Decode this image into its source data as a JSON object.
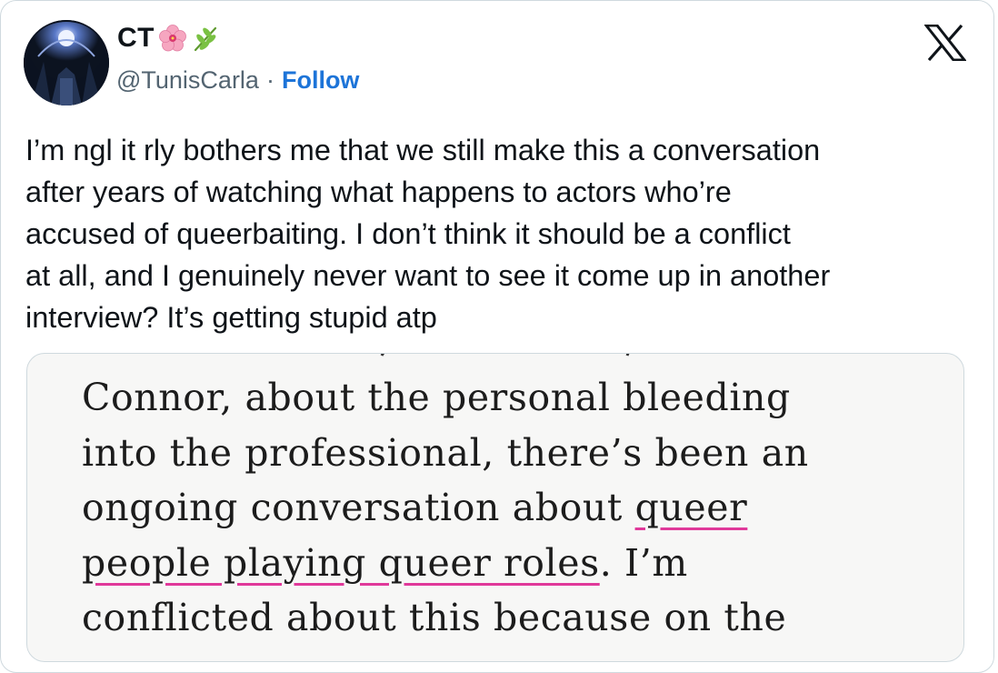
{
  "author": {
    "display_name": "CT",
    "handle": "@TunisCarla",
    "separator": "·",
    "follow_label": "Follow",
    "emoji_names": [
      "hibiscus-icon",
      "herb-icon"
    ]
  },
  "tweet": {
    "lines": [
      "I’m ngl it rly bothers me that we still make this a conversation",
      "after years of watching what happens to actors who’re",
      "accused of queerbaiting. I don’t think it should be a conflict",
      "at all, and I genuinely never want to see it come up in another",
      "interview? It’s getting stupid atp"
    ]
  },
  "media": {
    "line1": "Connor, about the personal bleeding",
    "line2": "into the professional, there’s been an",
    "line3_plain": "ongoing conversation about ",
    "line3_highlight": "queer",
    "line4_highlight": "people playing queer roles",
    "line4_plain": ". I’m",
    "line5": "conflicted about this because on the"
  },
  "colors": {
    "follow": "#1d74d8",
    "highlight_underline": "#e0399a",
    "secondary_text": "#536471",
    "border": "#cfd9de"
  }
}
